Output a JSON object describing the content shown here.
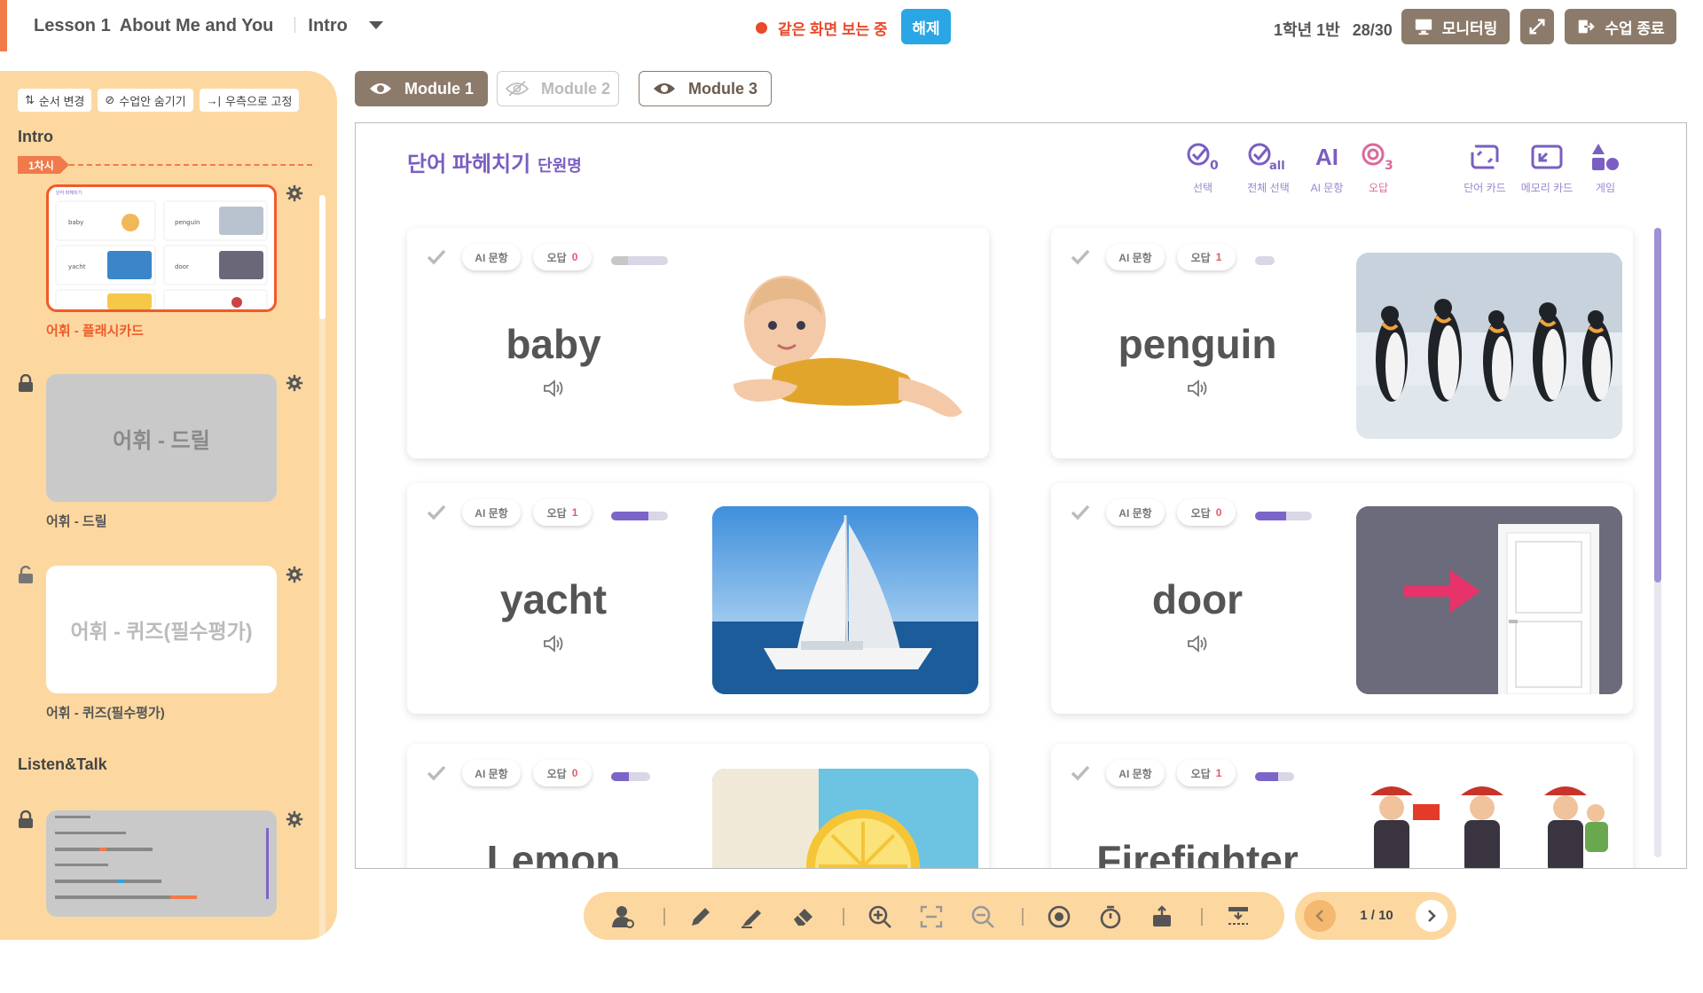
{
  "header": {
    "lesson": "Lesson 1",
    "lesson_title": "About Me and You",
    "section": "Intro",
    "live_status": "같은 화면 보는 중",
    "release_label": "해제",
    "class_name": "1학년 1반",
    "attendance": "28/30",
    "monitor_label": "모니터링",
    "end_label": "수업 종료"
  },
  "sidebar": {
    "tools": [
      "순서 변경",
      "수업안 숨기기",
      "우측으로 고정"
    ],
    "section1": "Intro",
    "chasi": "1차시",
    "items": [
      {
        "label": "어휘 - 플래시카드",
        "thumb_text": ""
      },
      {
        "label": "어휘 - 드릴",
        "thumb_text": "어휘 - 드릴"
      },
      {
        "label": "어휘 - 퀴즈(필수평가)",
        "thumb_text": "어휘 - 퀴즈(필수평가)"
      }
    ],
    "section2": "Listen&Talk"
  },
  "modules": [
    "Module 1",
    "Module 2",
    "Module 3"
  ],
  "content": {
    "title": "단어 파헤치기",
    "subtitle": "단원명",
    "tools": [
      {
        "label": "선택",
        "icon": "check-circle-0-icon"
      },
      {
        "label": "전체 선택",
        "icon": "check-circle-all-icon"
      },
      {
        "label": "AI 문항",
        "icon": "ai-icon"
      },
      {
        "label": "오답",
        "icon": "target-3-icon"
      },
      {
        "label": "단어 카드",
        "icon": "word-card-icon"
      },
      {
        "label": "메모리 카드",
        "icon": "memory-card-icon"
      },
      {
        "label": "게임",
        "icon": "game-icon"
      }
    ],
    "ai_label": "AI 문항",
    "wrong_label": "오답",
    "cards": [
      {
        "word": "baby",
        "wrong": "0",
        "progress": 0.3,
        "prog_gray": true,
        "image": "baby"
      },
      {
        "word": "penguin",
        "wrong": "1",
        "progress": 0.0,
        "prog_gray": false,
        "image": "penguins"
      },
      {
        "word": "yacht",
        "wrong": "1",
        "progress": 0.65,
        "prog_gray": false,
        "image": "sailboat"
      },
      {
        "word": "door",
        "wrong": "0",
        "progress": 0.55,
        "prog_gray": false,
        "image": "door"
      },
      {
        "word": "Lemon",
        "wrong": "0",
        "progress": 0.45,
        "prog_gray": false,
        "image": "lemon"
      },
      {
        "word": "Firefighter",
        "wrong": "1",
        "progress": 0.6,
        "prog_gray": false,
        "image": "firefighters"
      }
    ]
  },
  "pager": {
    "current": "1",
    "total": "10",
    "sep": "/"
  },
  "colors": {
    "accent": "#f07a4a",
    "purple": "#7a5ec2",
    "sidebar": "#fcd8a0",
    "blue": "#2aa6e4"
  }
}
